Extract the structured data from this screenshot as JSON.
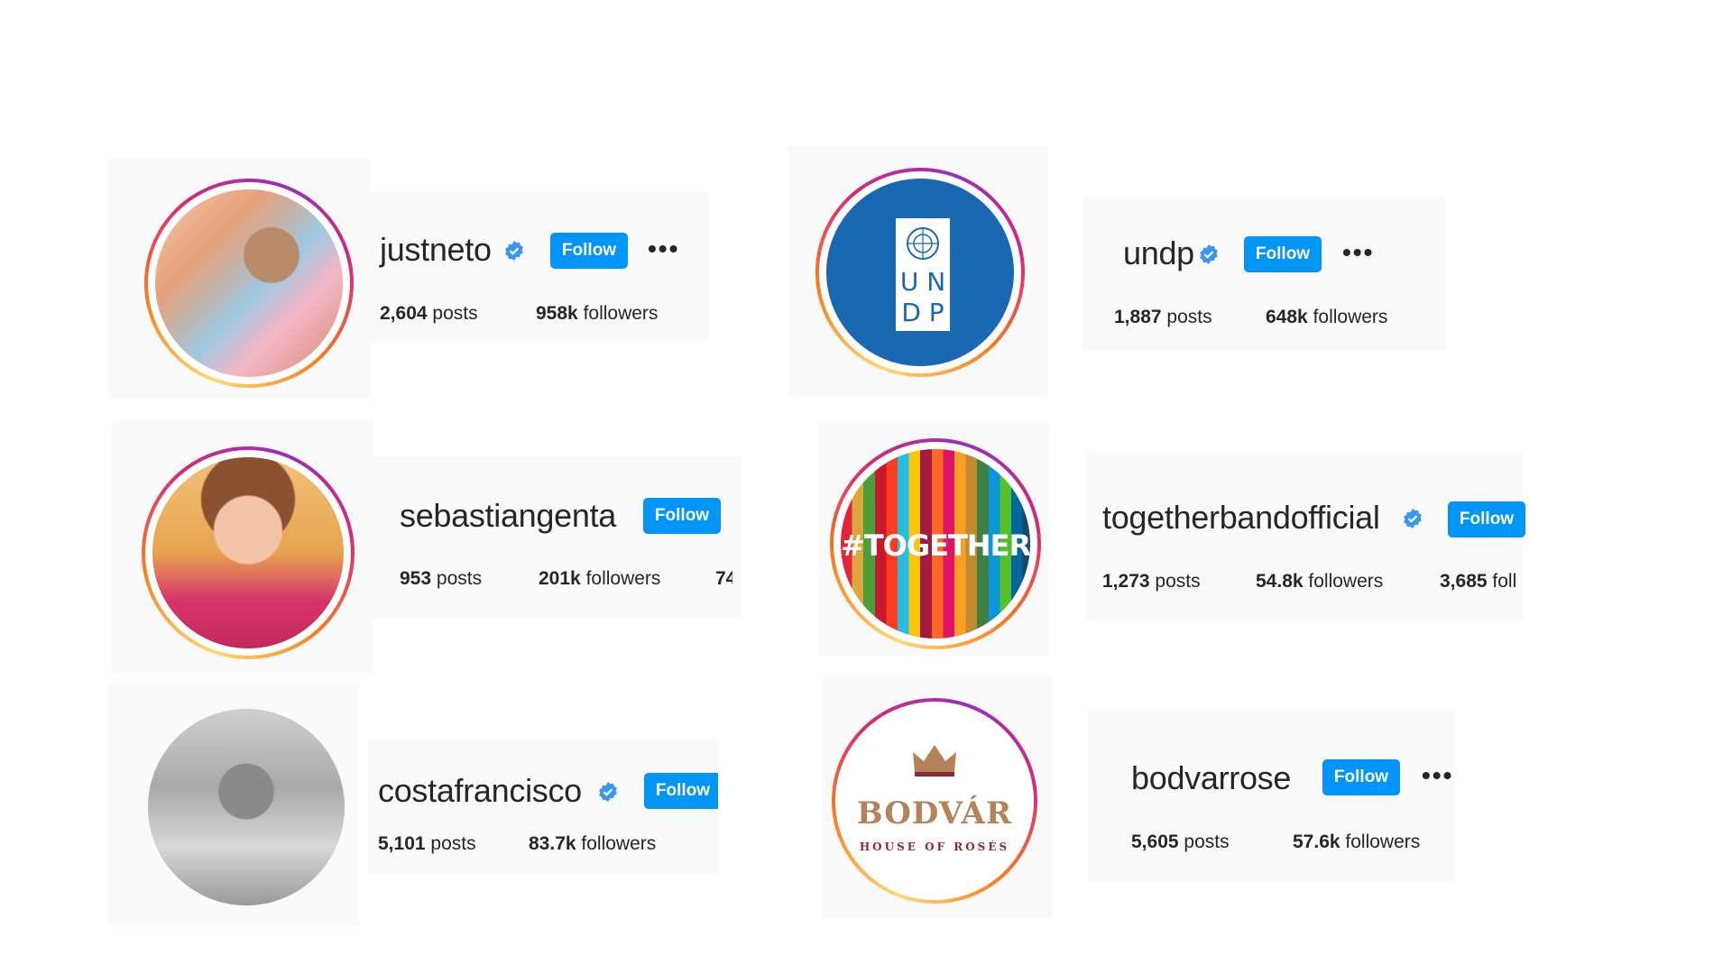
{
  "profiles": [
    {
      "username": "justneto",
      "verified": true,
      "follow_label": "Follow",
      "posts_count": "2,604",
      "posts_label": "posts",
      "followers_count": "958k",
      "followers_label": "followers",
      "more": "•••"
    },
    {
      "username": "undp",
      "verified": true,
      "follow_label": "Follow",
      "posts_count": "1,887",
      "posts_label": "posts",
      "followers_count": "648k",
      "followers_label": "followers",
      "more": "•••",
      "logo_top": "U N",
      "logo_bottom": "D P"
    },
    {
      "username": "sebastiangenta",
      "verified": false,
      "follow_label": "Follow",
      "posts_count": "953",
      "posts_label": "posts",
      "followers_count": "201k",
      "followers_label": "followers",
      "cut_stat": "74"
    },
    {
      "username": "togetherbandofficial",
      "verified": true,
      "follow_label": "Follow",
      "posts_count": "1,273",
      "posts_label": "posts",
      "followers_count": "54.8k",
      "followers_label": "followers",
      "following_count": "3,685",
      "following_label": "foll",
      "logo_text": "#TOGETHER"
    },
    {
      "username": "costafrancisco",
      "verified": true,
      "follow_label": "Follow",
      "posts_count": "5,101",
      "posts_label": "posts",
      "followers_count": "83.7k",
      "followers_label": "followers"
    },
    {
      "username": "bodvarrose",
      "verified": false,
      "follow_label": "Follow",
      "posts_count": "5,605",
      "posts_label": "posts",
      "followers_count": "57.6k",
      "followers_label": "followers",
      "more": "•••",
      "logo_top": "BODVÁR",
      "logo_bottom": "HOUSE OF ROSÉS"
    }
  ],
  "colors": {
    "follow_bg": "#0095f6",
    "verified": "#3897f0",
    "text": "#262626",
    "panel": "#fafafa"
  }
}
